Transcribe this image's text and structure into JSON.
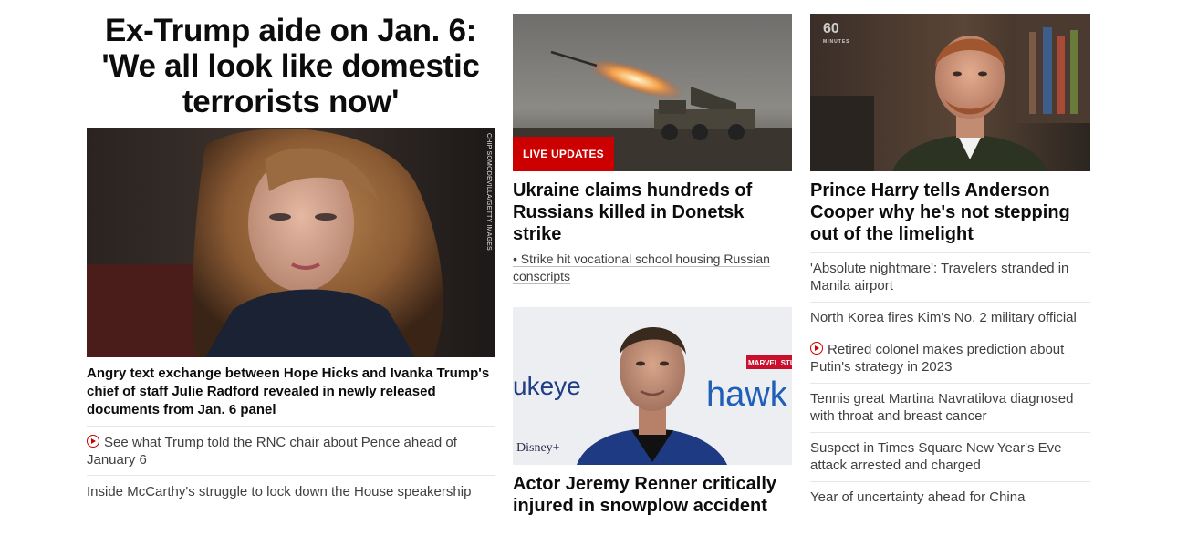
{
  "left": {
    "headline": "Ex-Trump aide on Jan. 6: 'We all look like domestic terrorists now'",
    "photo_credit": "CHIP SOMODEVILLA/GETTY IMAGES",
    "lead_story": "Angry text exchange between Hope Hicks and Ivanka Trump's chief of staff Julie Radford revealed in newly released documents from Jan. 6 panel",
    "links": [
      {
        "text": "See what Trump told the RNC chair about Pence ahead of January 6",
        "icon": "play-icon"
      },
      {
        "text": "Inside McCarthy's struggle to lock down the House speakership"
      }
    ]
  },
  "middle": {
    "ukraine": {
      "badge": "LIVE UPDATES",
      "headline": "Ukraine claims hundreds of Russians killed in Donetsk strike",
      "bullet": "• Strike hit vocational school housing Russian conscripts"
    },
    "renner": {
      "headline": "Actor Jeremy Renner critically injured in snowplow accident",
      "backdrop_text_left": "ukeye",
      "backdrop_text_right": "hawk",
      "backdrop_disney": "Disney+",
      "backdrop_marvel": "MARVEL STUDIOS"
    }
  },
  "right": {
    "logo": "60",
    "logo_sub": "MINUTES",
    "headline": "Prince Harry tells Anderson Cooper why he's not stepping out of the limelight",
    "links": [
      {
        "text": "'Absolute nightmare': Travelers stranded in Manila airport"
      },
      {
        "text": "North Korea fires Kim's No. 2 military official"
      },
      {
        "text": "Retired colonel makes prediction about Putin's strategy in 2023",
        "icon": "play-icon"
      },
      {
        "text": "Tennis great Martina Navratilova diagnosed with throat and breast cancer"
      },
      {
        "text": "Suspect in Times Square New Year's Eve attack arrested and charged"
      },
      {
        "text": "Year of uncertainty ahead for China"
      }
    ]
  },
  "colors": {
    "accent_red": "#cc0000",
    "headline_text": "#0c0c0c",
    "link_text": "#404040",
    "divider": "#e6e6e6"
  }
}
